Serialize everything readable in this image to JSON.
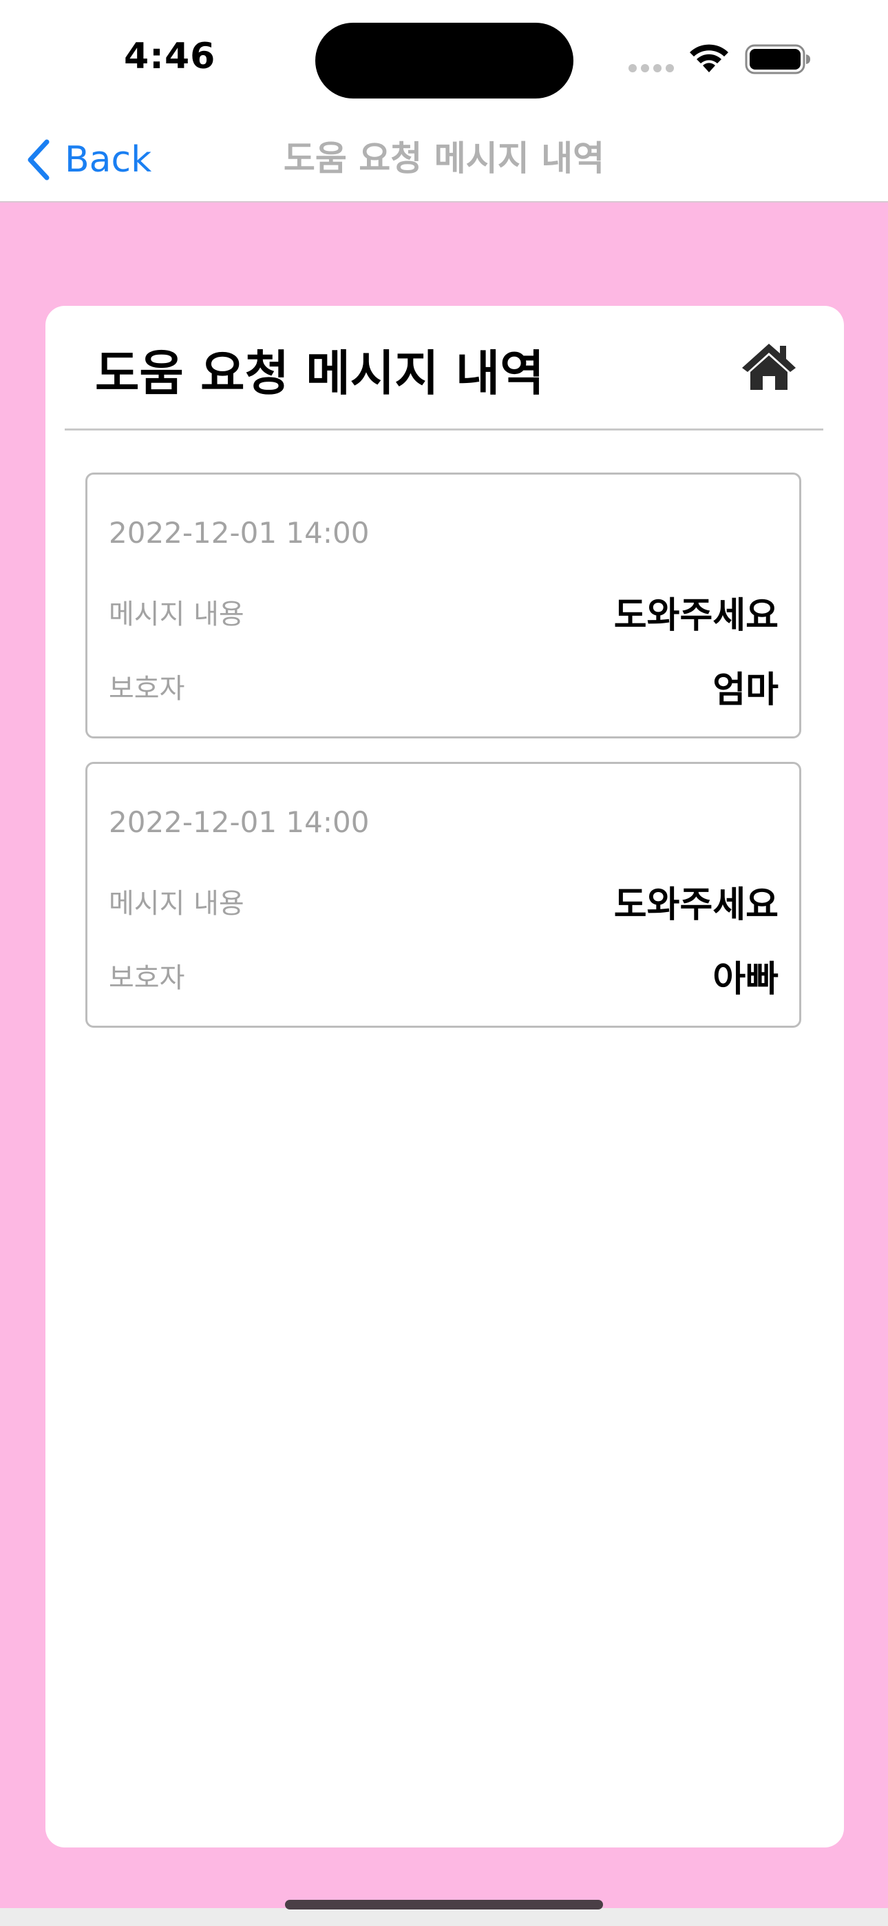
{
  "status_bar": {
    "time": "4:46"
  },
  "nav": {
    "back_label": "Back",
    "title": "도움 요청 메시지 내역"
  },
  "card": {
    "title": "도움 요청 메시지 내역",
    "home_icon": "home-icon"
  },
  "messages": [
    {
      "datetime": "2022-12-01 14:00",
      "content_label": "메시지 내용",
      "content_value": "도와주세요",
      "guardian_label": "보호자",
      "guardian_value": "엄마"
    },
    {
      "datetime": "2022-12-01 14:00",
      "content_label": "메시지 내용",
      "content_value": "도와주세요",
      "guardian_label": "보호자",
      "guardian_value": "아빠"
    }
  ],
  "colors": {
    "background": "#fdb8e3",
    "accent": "#1a7ff2",
    "muted_text": "#a3a3a3"
  }
}
